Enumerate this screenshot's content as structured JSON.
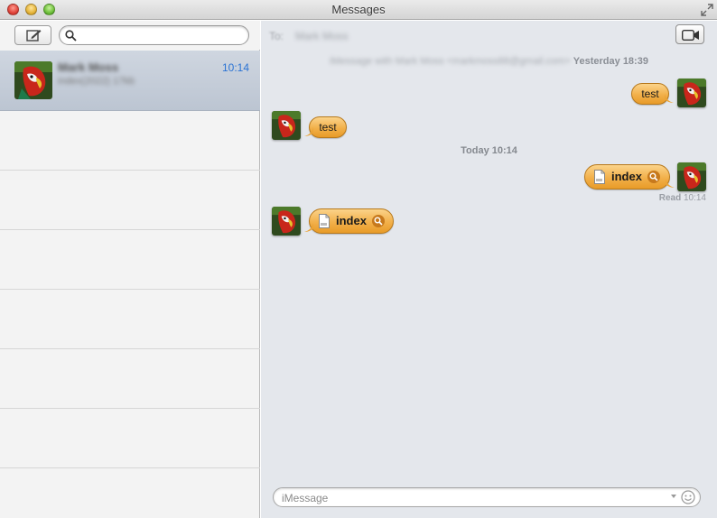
{
  "window": {
    "title": "Messages"
  },
  "sidebar": {
    "search": {
      "placeholder": "",
      "value": ""
    },
    "conversations": [
      {
        "name": "Mark Moss",
        "preview": "index(2022) 17kb",
        "time": "10:14",
        "selected": true
      }
    ]
  },
  "conversation": {
    "to_label": "To:",
    "to_name": "Mark Moss",
    "header": {
      "service_with": "iMessage with Mark Moss <markmoss88@gmail.com>",
      "when": "Yesterday 18:39"
    },
    "timestamp": "Today 10:14",
    "messages": [
      {
        "from": "me",
        "type": "text",
        "text": "test"
      },
      {
        "from": "them",
        "type": "text",
        "text": "test"
      },
      {
        "from": "me",
        "type": "file",
        "text": "index"
      },
      {
        "from": "them",
        "type": "file",
        "text": "index"
      }
    ],
    "read_receipt": {
      "label": "Read",
      "time": "10:14"
    }
  },
  "input": {
    "placeholder": "iMessage"
  },
  "colors": {
    "bubble": "#f2b04a",
    "time_accent": "#2b73d4",
    "selection": "#c6ceda"
  },
  "icons": [
    "close-icon",
    "minimize-icon",
    "zoom-icon",
    "fullscreen-icon",
    "compose-icon",
    "search-icon",
    "video-camera-icon",
    "file-icon",
    "quicklook-icon",
    "emoji-icon"
  ]
}
